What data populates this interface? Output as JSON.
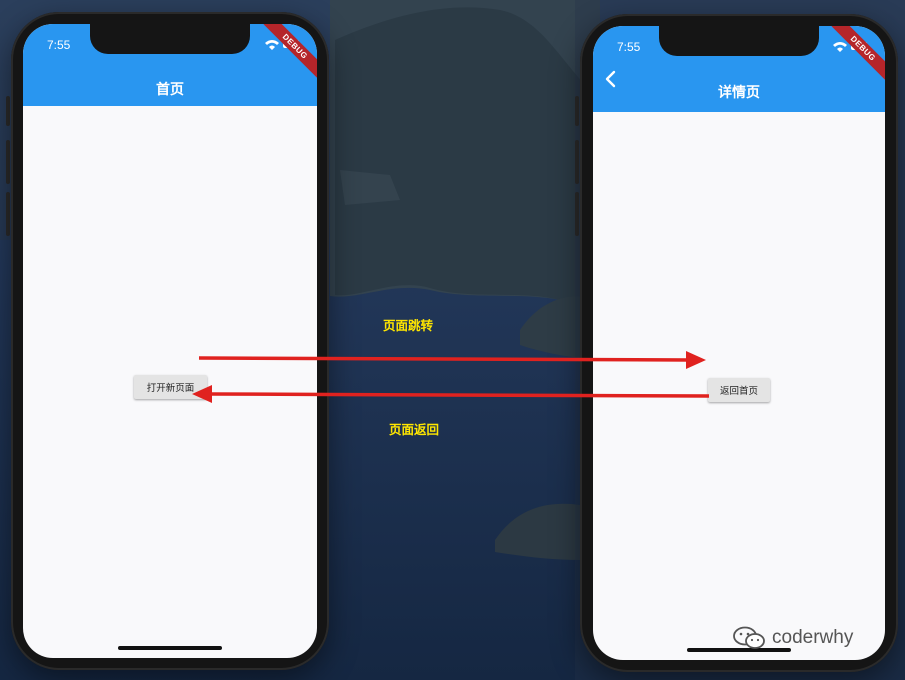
{
  "left_screen": {
    "status_time": "7:55",
    "title": "首页",
    "debug_label": "DEBUG",
    "button_label": "打开新页面"
  },
  "right_screen": {
    "status_time": "7:55",
    "title": "详情页",
    "debug_label": "DEBUG",
    "button_label": "返回首页"
  },
  "annotations": {
    "forward": "页面跳转",
    "back": "页面返回"
  },
  "watermark": "coderwhy",
  "colors": {
    "appbar": "#2996f0",
    "arrow": "#e0221f",
    "annotation": "#ffe600",
    "debug_banner": "#b5252a"
  }
}
